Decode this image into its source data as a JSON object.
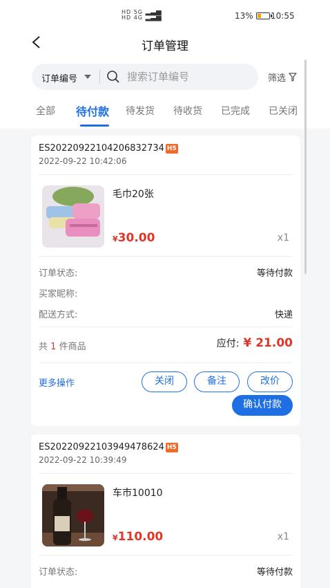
{
  "status_bar": {
    "sig1": "HD 5G",
    "sig2": "HD 4G",
    "battery": "13%",
    "time": "10:55"
  },
  "header": {
    "title": "订单管理"
  },
  "search": {
    "type_label": "订单编号",
    "placeholder": "搜索订单编号",
    "filter_label": "筛选"
  },
  "tabs": [
    {
      "label": "全部"
    },
    {
      "label": "待付款",
      "active": true
    },
    {
      "label": "待发货"
    },
    {
      "label": "待收货"
    },
    {
      "label": "已完成"
    },
    {
      "label": "已关闭"
    }
  ],
  "orders": [
    {
      "order_no": "ES20220922104206832734",
      "badge": "H5",
      "time": "2022-09-22 10:42:06",
      "product_name": "毛巾20张",
      "price_symbol": "¥",
      "price": "30.00",
      "quantity": "x1",
      "status_label": "订单状态:",
      "status_value": "等待付款",
      "buyer_label": "买家昵称:",
      "buyer_value": "",
      "delivery_label": "配送方式:",
      "delivery_value": "快递",
      "count_prefix": "共",
      "count": "1",
      "count_suffix": "件商品",
      "payable_label": "应付:",
      "payable_amount": "¥ 21.00",
      "more_label": "更多操作",
      "buttons": {
        "close": "关闭",
        "remark": "备注",
        "change_price": "改价",
        "confirm": "确认付款"
      }
    },
    {
      "order_no": "ES20220922103949478624",
      "badge": "H5",
      "time": "2022-09-22 10:39:49",
      "product_name": "车市10010",
      "price_symbol": "¥",
      "price": "110.00",
      "quantity": "x1",
      "status_label": "订单状态:",
      "status_value": "等待付款"
    }
  ],
  "colors": {
    "accent": "#1e6fe3",
    "price": "#e0362a",
    "badge": "#ef6b2c",
    "background": "#f5f6f8"
  }
}
